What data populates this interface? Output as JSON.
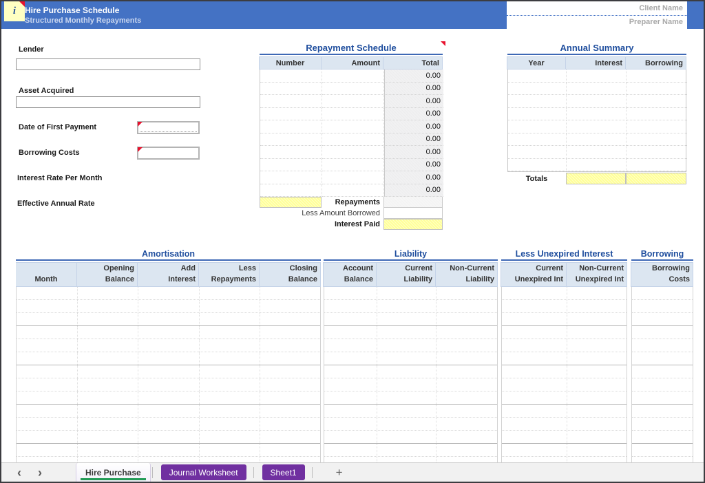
{
  "header": {
    "title": "Hire Purchase Schedule",
    "subtitle": "Structured Monthly Repayments",
    "info_icon": "i",
    "client_name_label": "Client Name",
    "preparer_name_label": "Preparer Name"
  },
  "form": {
    "lender_label": "Lender",
    "asset_label": "Asset Acquired",
    "date_label": "Date of First Payment",
    "borrowing_label": "Borrowing Costs",
    "interest_rate_label": "Interest Rate Per Month",
    "effective_rate_label": "Effective Annual Rate"
  },
  "repayment_schedule": {
    "title": "Repayment Schedule",
    "columns": [
      "Number",
      "Amount",
      "Total"
    ],
    "totals": [
      "0.00",
      "0.00",
      "0.00",
      "0.00",
      "0.00",
      "0.00",
      "0.00",
      "0.00",
      "0.00",
      "0.00"
    ],
    "repayments_label": "Repayments",
    "less_amount_borrowed_label": "Less Amount Borrowed",
    "interest_paid_label": "Interest Paid"
  },
  "annual_summary": {
    "title": "Annual Summary",
    "columns": [
      "Year",
      "Interest",
      "Borrowing"
    ],
    "row_count": 8,
    "totals_label": "Totals"
  },
  "detail_table": {
    "row_count": 14,
    "group_size": 3,
    "sections": [
      {
        "title": "Amortisation",
        "columns": [
          "Month",
          "Opening\nBalance",
          "Add\nInterest",
          "Less\nRepayments",
          "Closing\nBalance"
        ]
      },
      {
        "title": "Liability",
        "columns": [
          "Account\nBalance",
          "Current\nLiability",
          "Non-Current\nLiability"
        ]
      },
      {
        "title": "Less Unexpired Interest",
        "columns": [
          "Current\nUnexpired Int",
          "Non-Current\nUnexpired Int"
        ]
      },
      {
        "title": "Borrowing",
        "columns": [
          "Borrowing\nCosts"
        ]
      }
    ]
  },
  "tabs": {
    "nav_prev": "‹",
    "nav_next": "›",
    "active": "Hire Purchase",
    "others": [
      "Journal Worksheet",
      "Sheet1"
    ],
    "add_label": "+"
  },
  "colors": {
    "accent_blue": "#4472C4",
    "title_blue": "#1F4E9E",
    "header_fill": "#DCE6F1",
    "highlight_yellow": "#FFFF99",
    "tab_purple": "#7030A0",
    "active_tab_green": "#239B56",
    "comment_marker_red": "#E8112D"
  }
}
